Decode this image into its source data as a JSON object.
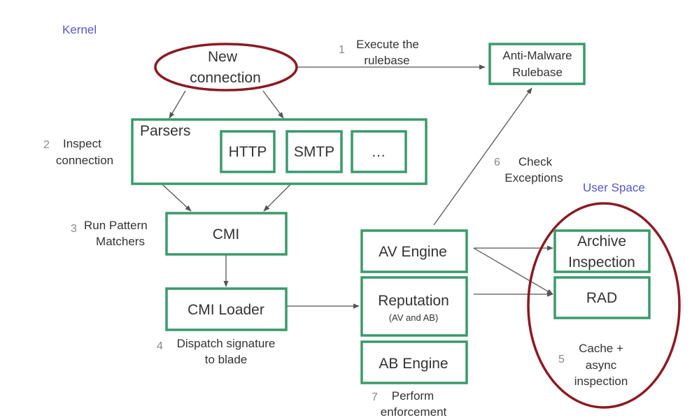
{
  "regions": {
    "kernel": "Kernel",
    "user_space": "User Space"
  },
  "colors": {
    "box_border": "#3a9a6a",
    "ellipse_border": "#8b1a22",
    "region_label": "#5555cc"
  },
  "nodes": {
    "new_connection": [
      "New",
      "connection"
    ],
    "anti_malware": [
      "Anti-Malware",
      "Rulebase"
    ],
    "parsers": {
      "title": "Parsers",
      "items": [
        "HTTP",
        "SMTP",
        "…"
      ]
    },
    "cmi": "CMI",
    "cmi_loader": "CMI Loader",
    "av_engine": "AV Engine",
    "reputation": {
      "title": "Reputation",
      "sub": "(AV and AB)"
    },
    "ab_engine": "AB Engine",
    "archive": [
      "Archive",
      "Inspection"
    ],
    "rad": "RAD"
  },
  "steps": [
    {
      "num": "1",
      "lines": [
        "Execute the",
        "rulebase"
      ]
    },
    {
      "num": "2",
      "lines": [
        "Inspect",
        "connection"
      ]
    },
    {
      "num": "3",
      "lines": [
        "Run Pattern",
        "Matchers"
      ]
    },
    {
      "num": "4",
      "lines": [
        "Dispatch signature",
        "to blade"
      ]
    },
    {
      "num": "5",
      "lines": [
        "Cache +",
        "async",
        "inspection"
      ]
    },
    {
      "num": "6",
      "lines": [
        "Check",
        "Exceptions"
      ]
    },
    {
      "num": "7",
      "lines": [
        "Perform",
        "enforcement"
      ]
    }
  ]
}
